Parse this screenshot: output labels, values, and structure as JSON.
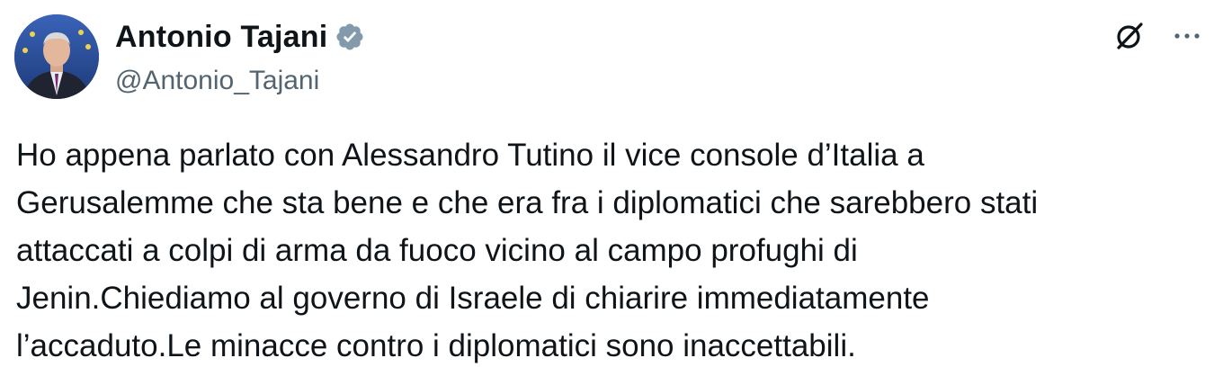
{
  "author": {
    "display_name": "Antonio Tajani",
    "handle": "@Antonio_Tajani",
    "verified_icon": "verified-badge-icon",
    "avatar": "profile-photo"
  },
  "actions": {
    "grok_icon": "grok-icon",
    "more_icon": "more-options-icon"
  },
  "tweet": {
    "lines": [
      "Ho appena parlato con Alessandro Tutino il vice console d’Italia a",
      "Gerusalemme che sta bene e che era fra i diplomatici che sarebbero stati",
      "attaccati a colpi di arma da fuoco vicino al campo profughi di",
      "Jenin.Chiediamo al governo di Israele di chiarire immediatamente",
      "l’accaduto.Le minacce contro i diplomatici sono inaccettabili."
    ]
  },
  "colors": {
    "text": "#0f1419",
    "secondary": "#536471",
    "badge": "#829aab"
  }
}
